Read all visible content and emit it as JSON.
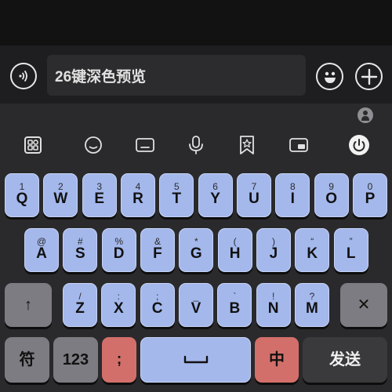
{
  "chat": {
    "input_text": "26键深色预览"
  },
  "keyboard": {
    "rows": [
      [
        {
          "main": "Q",
          "sub": "1"
        },
        {
          "main": "W",
          "sub": "2"
        },
        {
          "main": "E",
          "sub": "3"
        },
        {
          "main": "R",
          "sub": "4"
        },
        {
          "main": "T",
          "sub": "5"
        },
        {
          "main": "Y",
          "sub": "6"
        },
        {
          "main": "U",
          "sub": "7"
        },
        {
          "main": "I",
          "sub": "8"
        },
        {
          "main": "O",
          "sub": "9"
        },
        {
          "main": "P",
          "sub": "0"
        }
      ],
      [
        {
          "main": "A",
          "sub": "@"
        },
        {
          "main": "S",
          "sub": "#"
        },
        {
          "main": "D",
          "sub": "%"
        },
        {
          "main": "F",
          "sub": "&"
        },
        {
          "main": "G",
          "sub": "*"
        },
        {
          "main": "H",
          "sub": "("
        },
        {
          "main": "J",
          "sub": ")"
        },
        {
          "main": "K",
          "sub": "“"
        },
        {
          "main": "L",
          "sub": "”"
        }
      ],
      [
        {
          "main": "Z",
          "sub": "/"
        },
        {
          "main": "X",
          "sub": ":"
        },
        {
          "main": "C",
          "sub": ";"
        },
        {
          "main": "V",
          "sub": "_"
        },
        {
          "main": "B",
          "sub": "`"
        },
        {
          "main": "N",
          "sub": "!"
        },
        {
          "main": "M",
          "sub": "?"
        }
      ]
    ],
    "shift_label": "↑",
    "delete_label": "✕",
    "symbols_label": "符",
    "numbers_label": "123",
    "semicolon_label": ";",
    "semicolon_sub": "，",
    "space_label": "␣",
    "lang_label": "中",
    "send_label": "发送"
  },
  "colors": {
    "key_blue": "#a4b8ec",
    "key_gray": "#7c7c82",
    "key_red": "#d36f6a",
    "key_dark": "#3a3a3c",
    "background": "#2a2a2c"
  }
}
